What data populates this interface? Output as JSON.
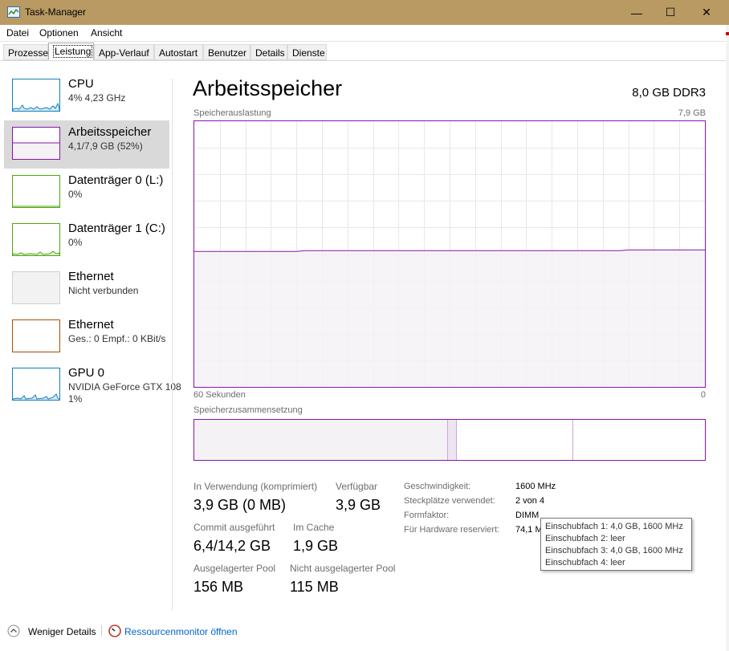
{
  "window": {
    "title": "Task-Manager",
    "minimize_glyph": "—",
    "maximize_glyph": "☐",
    "close_glyph": "✕"
  },
  "menu": [
    "Datei",
    "Optionen",
    "Ansicht"
  ],
  "tabs": [
    "Prozesse",
    "Leistung",
    "App-Verlauf",
    "Autostart",
    "Benutzer",
    "Details",
    "Dienste"
  ],
  "active_tab": "Leistung",
  "sidebar": [
    {
      "name": "CPU",
      "sub": "4%  4,23 GHz",
      "color": "#117dbb"
    },
    {
      "name": "Arbeitsspeicher",
      "sub": "4,1/7,9 GB (52%)",
      "color": "#8b12ae"
    },
    {
      "name": "Datenträger 0 (L:)",
      "sub": "0%",
      "color": "#4da60c"
    },
    {
      "name": "Datenträger 1 (C:)",
      "sub": "0%",
      "color": "#4da60c"
    },
    {
      "name": "Ethernet",
      "sub": "Nicht verbunden",
      "color": "#d0d0d0"
    },
    {
      "name": "Ethernet",
      "sub": "Ges.: 0  Empf.: 0 KBit/s",
      "color": "#a74f01"
    },
    {
      "name": "GPU 0",
      "sub": "NVIDIA GeForce GTX 108",
      "sub2": "1%",
      "color": "#117dbb"
    }
  ],
  "main": {
    "title": "Arbeitsspeicher",
    "spec": "8,0 GB DDR3",
    "usage_label": "Speicherauslastung",
    "usage_max": "7,9 GB",
    "time_label": "60 Sekunden",
    "time_zero": "0",
    "composition_label": "Speicherzusammensetzung",
    "usage_fraction": 0.51,
    "stats": {
      "in_use_label": "In Verwendung (komprimiert)",
      "in_use_value": "3,9 GB (0 MB)",
      "available_label": "Verfügbar",
      "available_value": "3,9 GB",
      "commit_label": "Commit ausgeführt",
      "commit_value": "6,4/14,2 GB",
      "cached_label": "Im Cache",
      "cached_value": "1,9 GB",
      "paged_label": "Ausgelagerter Pool",
      "paged_value": "156 MB",
      "nonpaged_label": "Nicht ausgelagerter Pool",
      "nonpaged_value": "115 MB"
    },
    "details": {
      "speed_label": "Geschwindigkeit:",
      "speed_value": "1600 MHz",
      "slots_label": "Steckplätze verwendet:",
      "slots_value": "2 von 4",
      "form_label": "Formfaktor:",
      "form_value": "DIMM",
      "reserved_label": "Für Hardware reserviert:",
      "reserved_value": "74,1 M"
    },
    "tooltip": [
      "Einschubfach 1: 4,0 GB, 1600 MHz",
      "Einschubfach 2: leer",
      "Einschubfach 3: 4,0 GB, 1600 MHz",
      "Einschubfach 4: leer"
    ]
  },
  "footer": {
    "fewer_details": "Weniger Details",
    "resource_monitor": "Ressourcenmonitor öffnen"
  },
  "colors": {
    "titlebar": "#b99a63",
    "memory": "#8b12ae",
    "memory_fill": "#f4f2f4",
    "link": "#0066cc"
  }
}
